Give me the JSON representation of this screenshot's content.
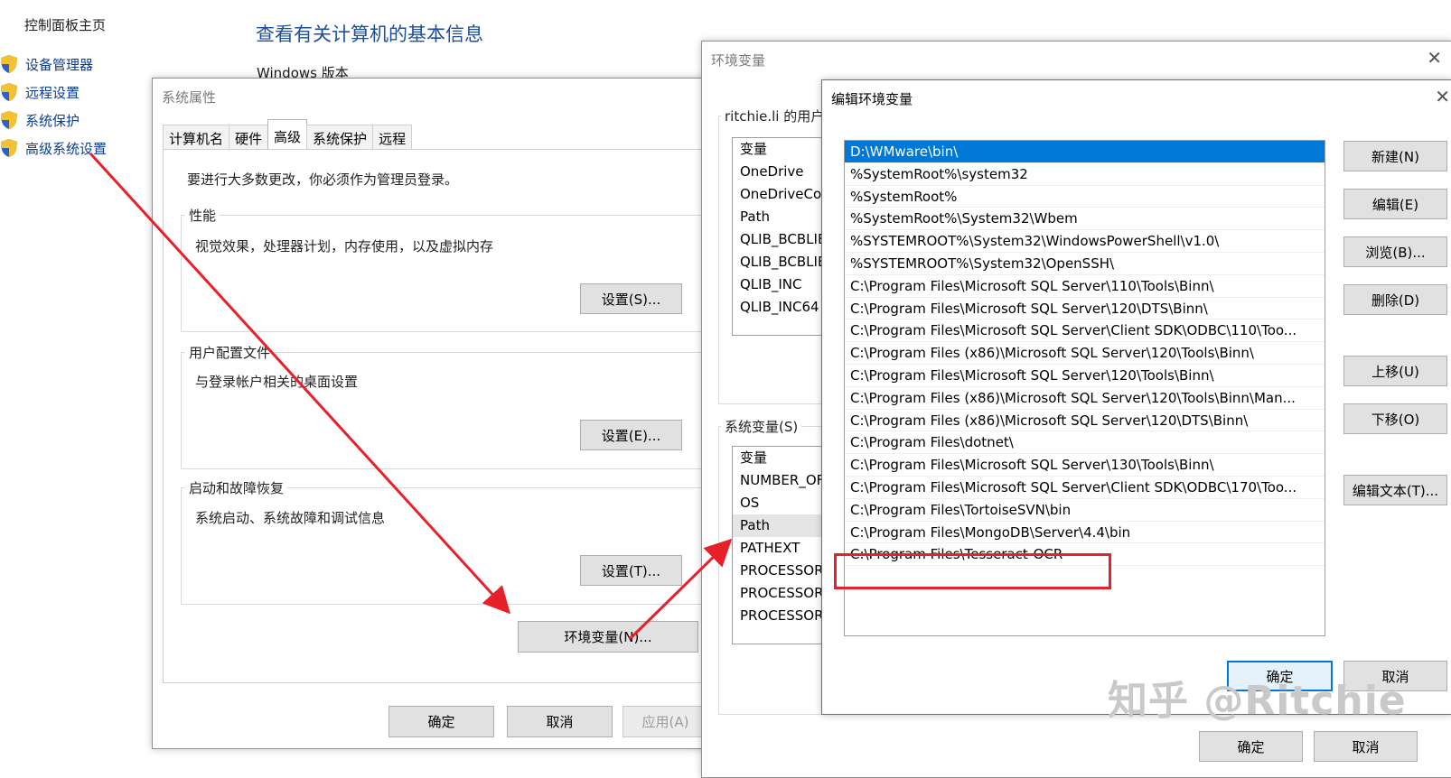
{
  "control_panel": {
    "home_label": "控制面板主页",
    "links": [
      "设备管理器",
      "远程设置",
      "系统保护",
      "高级系统设置"
    ],
    "title": "查看有关计算机的基本信息",
    "windows_version": "Windows 版本"
  },
  "system_properties": {
    "title": "系统属性",
    "tabs": [
      "计算机名",
      "硬件",
      "高级",
      "系统保护",
      "远程"
    ],
    "admin_note": "要进行大多数更改，你必须作为管理员登录。",
    "performance": {
      "title": "性能",
      "desc": "视觉效果，处理器计划，内存使用，以及虚拟内存",
      "button": "设置(S)..."
    },
    "user_profiles": {
      "title": "用户配置文件",
      "desc": "与登录帐户相关的桌面设置",
      "button": "设置(E)..."
    },
    "startup_recovery": {
      "title": "启动和故障恢复",
      "desc": "系统启动、系统故障和调试信息",
      "button": "设置(T)..."
    },
    "env_button": "环境变量(N)...",
    "ok": "确定",
    "cancel": "取消",
    "apply": "应用(A)"
  },
  "env_vars": {
    "title": "环境变量",
    "user_group": "ritchie.li 的用户",
    "user_rows": [
      "变量",
      "OneDrive",
      "OneDriveCo",
      "Path",
      "QLIB_BCBLIB",
      "QLIB_BCBLIB",
      "QLIB_INC",
      "QLIB_INC64"
    ],
    "system_group": "系统变量(S)",
    "system_rows": [
      "变量",
      "NUMBER_OF",
      "OS",
      "Path",
      "PATHEXT",
      "PROCESSOR",
      "PROCESSOR",
      "PROCESSOR"
    ],
    "ok": "确定",
    "cancel": "取消"
  },
  "edit_env": {
    "title": "编辑环境变量",
    "paths": [
      "D:\\WMware\\bin\\",
      "%SystemRoot%\\system32",
      "%SystemRoot%",
      "%SystemRoot%\\System32\\Wbem",
      "%SYSTEMROOT%\\System32\\WindowsPowerShell\\v1.0\\",
      "%SYSTEMROOT%\\System32\\OpenSSH\\",
      "C:\\Program Files\\Microsoft SQL Server\\110\\Tools\\Binn\\",
      "C:\\Program Files\\Microsoft SQL Server\\120\\DTS\\Binn\\",
      "C:\\Program Files\\Microsoft SQL Server\\Client SDK\\ODBC\\110\\Too...",
      "C:\\Program Files (x86)\\Microsoft SQL Server\\120\\Tools\\Binn\\",
      "C:\\Program Files\\Microsoft SQL Server\\120\\Tools\\Binn\\",
      "C:\\Program Files (x86)\\Microsoft SQL Server\\120\\Tools\\Binn\\Man...",
      "C:\\Program Files (x86)\\Microsoft SQL Server\\120\\DTS\\Binn\\",
      "C:\\Program Files\\dotnet\\",
      "C:\\Program Files\\Microsoft SQL Server\\130\\Tools\\Binn\\",
      "C:\\Program Files\\Microsoft SQL Server\\Client SDK\\ODBC\\170\\Too...",
      "C:\\Program Files\\TortoiseSVN\\bin",
      "C:\\Program Files\\MongoDB\\Server\\4.4\\bin",
      "C:\\Program Files\\Tesseract-OCR"
    ],
    "buttons": {
      "new": "新建(N)",
      "edit": "编辑(E)",
      "browse": "浏览(B)...",
      "delete": "删除(D)",
      "up": "上移(U)",
      "down": "下移(O)",
      "edit_text": "编辑文本(T)..."
    },
    "ok": "确定",
    "cancel": "取消"
  },
  "watermark": "知乎 @Ritchie",
  "colors": {
    "selection": "#0078d7",
    "annotation": "#e8202a",
    "link": "#0b3d91"
  }
}
